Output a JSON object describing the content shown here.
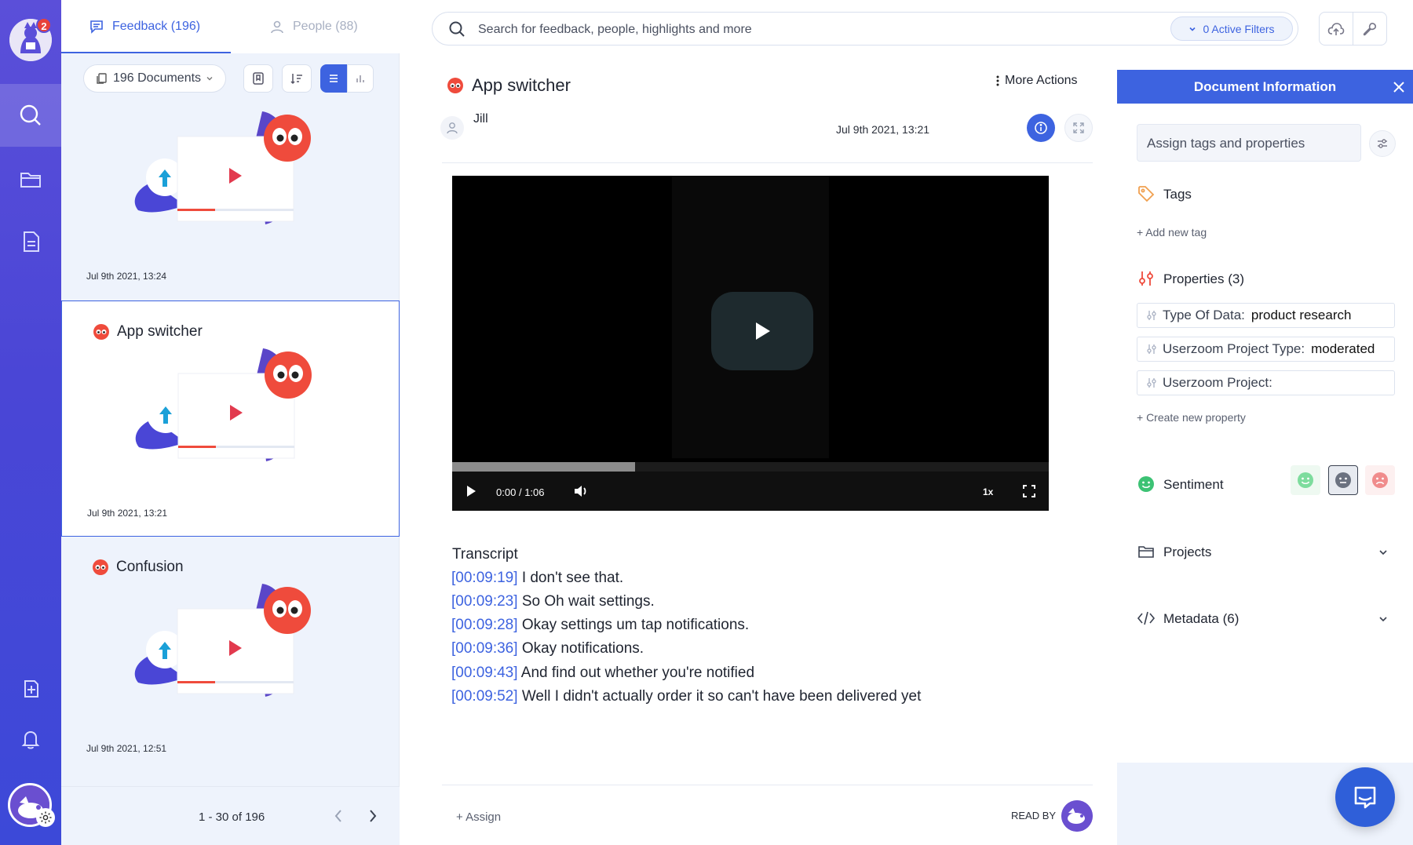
{
  "rail": {
    "notification_count": "2",
    "items": [
      "search-icon",
      "folder-icon",
      "document-icon",
      "add-page-icon",
      "bell-icon"
    ]
  },
  "feed": {
    "tabs": [
      {
        "label": "Feedback (196)",
        "active": true
      },
      {
        "label": "People (88)",
        "active": false
      }
    ],
    "documents_label": "196 Documents",
    "cards": [
      {
        "title": "",
        "date": "Jul 9th 2021, 13:24"
      },
      {
        "title": "App switcher",
        "date": "Jul 9th 2021, 13:21"
      },
      {
        "title": "Confusion",
        "date": "Jul 9th 2021, 12:51"
      }
    ],
    "pagination": "1 - 30 of 196"
  },
  "search": {
    "placeholder": "Search for feedback, people, highlights and more",
    "filters_label": "0 Active Filters"
  },
  "document": {
    "title": "App switcher",
    "more_actions": "More Actions",
    "author": "Jill",
    "date": "Jul 9th 2021, 13:21",
    "video": {
      "current_time": "0:00",
      "separator": "/",
      "duration": "1:06",
      "speed": "1x",
      "progress_fraction": 0.307
    },
    "transcript_title": "Transcript",
    "transcript": [
      {
        "ts": "[00:09:19]",
        "text": "I don't see that."
      },
      {
        "ts": "[00:09:23]",
        "text": "So Oh wait settings."
      },
      {
        "ts": "[00:09:28]",
        "text": "Okay settings um tap notifications."
      },
      {
        "ts": "[00:09:36]",
        "text": "Okay notifications."
      },
      {
        "ts": "[00:09:43]",
        "text": "And find out whether you're notified"
      },
      {
        "ts": "[00:09:52]",
        "text": "Well I didn't actually order it so can't have been delivered yet"
      }
    ],
    "assign_label": "+ Assign",
    "read_by_label": "READ BY"
  },
  "panel": {
    "title": "Document Information",
    "tag_placeholder": "Assign tags and properties",
    "tags_title": "Tags",
    "add_tag": "+ Add new tag",
    "properties_title": "Properties (3)",
    "properties": [
      {
        "key": "Type Of Data:",
        "value": "product research"
      },
      {
        "key": "Userzoom Project Type:",
        "value": "moderated"
      },
      {
        "key": "Userzoom Project:",
        "value": ""
      }
    ],
    "create_property": "+ Create new property",
    "sentiment_title": "Sentiment",
    "sentiment_selected": "neutral",
    "projects_title": "Projects",
    "metadata_title": "Metadata (6)"
  },
  "colors": {
    "accent": "#3d63e0",
    "rail_top": "#5b4fd9",
    "rail_bottom": "#3c49d8",
    "feed_bg": "#eef3fc",
    "badge_red": "#e8413a",
    "owl_red": "#ef4b3c"
  }
}
